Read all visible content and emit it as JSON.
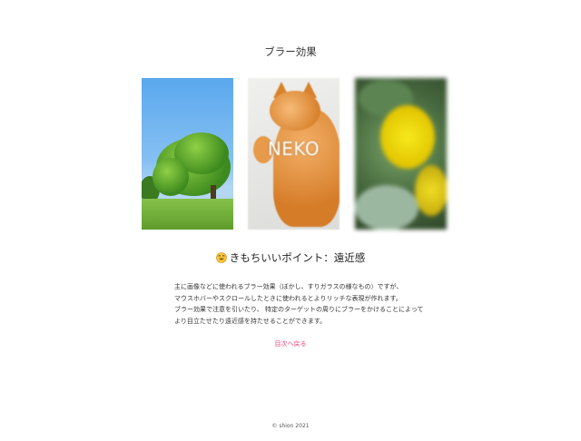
{
  "page": {
    "title": "ブラー効果"
  },
  "gallery": {
    "items": [
      {
        "name": "tree"
      },
      {
        "name": "cat",
        "caption": "NEKO"
      },
      {
        "name": "flower"
      }
    ]
  },
  "point": {
    "icon": "smiling-face-emoji-icon",
    "heading": "きもちいいポイント：遠近感"
  },
  "description": {
    "lines": [
      "主に画像などに使われるブラー効果（ぼかし、すりガラスの様なもの）ですが、",
      "マウスホバーやスクロールしたときに使われるとよりリッチな表現が作れます。",
      "ブラー効果で注意を引いたり、 特定のターゲットの周りにブラーをかけることによって",
      "より目立たせたり遠近感を持たせることができます。"
    ]
  },
  "nav": {
    "back_label": "目次へ戻る"
  },
  "footer": {
    "copyright": "© shion 2021"
  },
  "colors": {
    "link": "#e2457d",
    "text": "#333333",
    "background": "#ffffff"
  }
}
